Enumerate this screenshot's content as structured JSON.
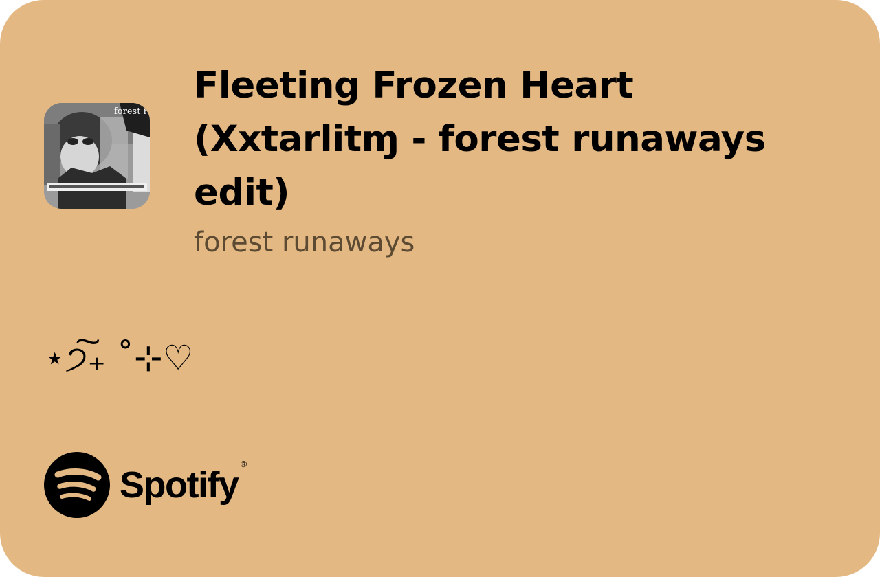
{
  "card": {
    "background_color": "#e3b883"
  },
  "track": {
    "title": "Fleeting Frozen Heart (Xxtarlitɱ - forest runaways edit)",
    "artist": "forest runaways",
    "artwork_text": "forest runaways"
  },
  "caption": "⋆੭͠₊ ˚⊹♡",
  "brand": {
    "name": "Spotify",
    "registered_mark": "®",
    "icon": "spotify-logo-icon"
  }
}
